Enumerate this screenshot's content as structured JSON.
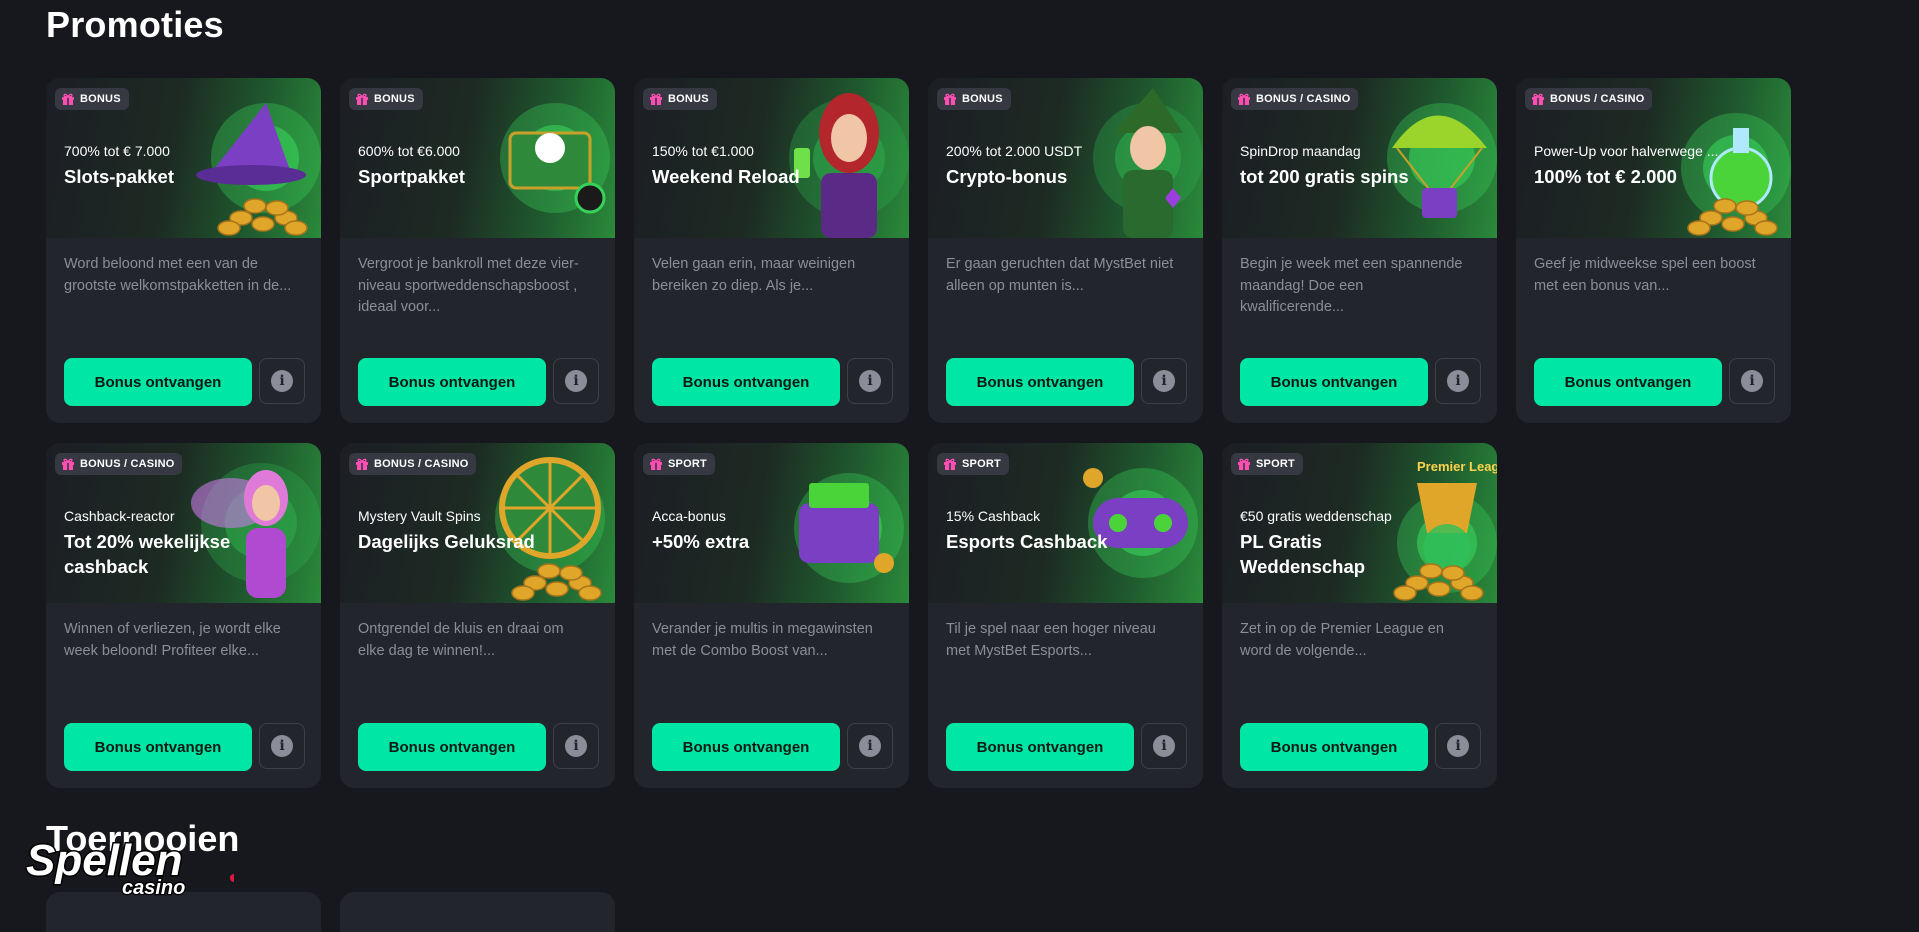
{
  "page_title": "Promoties",
  "next_section_title": "Toernooien",
  "watermark": {
    "brand": "Spellen",
    "sub": "casino"
  },
  "colors": {
    "accent": "#00e6a4",
    "card_bg": "#23252d",
    "page_bg": "#17181d",
    "badge_bg": "#363842",
    "gift": "#ff4fb3"
  },
  "cards": [
    {
      "badge": "BONUS",
      "subtitle": "700% tot € 7.000",
      "title": "Slots-pakket",
      "desc": "Word beloond met een van de grootste welkomstpakketten in de...",
      "button": "Bonus ontvangen",
      "icon": "gift-icon",
      "art": "witch-hat-gold"
    },
    {
      "badge": "BONUS",
      "subtitle": "600% tot €6.000",
      "title": "Sportpakket",
      "desc": "Vergroot je bankroll met deze vier-niveau sportweddenschapsboost , ideaal voor...",
      "button": "Bonus ontvangen",
      "icon": "gift-icon",
      "art": "treasure-chest"
    },
    {
      "badge": "BONUS",
      "subtitle": "150% tot €1.000",
      "title": "Weekend Reload",
      "desc": "Velen gaan erin, maar weinigen bereiken zo diep. Als je...",
      "button": "Bonus ontvangen",
      "icon": "gift-icon",
      "art": "red-hair-woman"
    },
    {
      "badge": "BONUS",
      "subtitle": "200% tot 2.000 USDT",
      "title": "Crypto-bonus",
      "desc": "Er gaan geruchten dat MystBet niet alleen op munten is...",
      "button": "Bonus ontvangen",
      "icon": "gift-icon",
      "art": "green-wizard"
    },
    {
      "badge": "BONUS / CASINO",
      "subtitle": "SpinDrop maandag",
      "title": "tot 200 gratis spins",
      "desc": "Begin je week met een spannende maandag! Doe een kwalificerende...",
      "button": "Bonus ontvangen",
      "icon": "gift-icon",
      "art": "parachute"
    },
    {
      "badge": "BONUS / CASINO",
      "subtitle": "Power-Up voor halverwege ...",
      "title": "100% tot € 2.000",
      "desc": "Geef je midweekse spel een boost met een bonus van...",
      "button": "Bonus ontvangen",
      "icon": "gift-icon",
      "art": "potion"
    },
    {
      "badge": "BONUS / CASINO",
      "subtitle": "Cashback-reactor",
      "title": "Tot 20% wekelijkse cashback",
      "desc": "Winnen of verliezen, je wordt elke week beloond! Profiteer elke...",
      "button": "Bonus ontvangen",
      "icon": "gift-icon",
      "art": "fairy"
    },
    {
      "badge": "BONUS / CASINO",
      "subtitle": "Mystery Vault Spins",
      "title": "Dagelijks Geluksrad",
      "desc": "Ontgrendel de kluis en draai om elke dag te winnen!...",
      "button": "Bonus ontvangen",
      "icon": "gift-icon",
      "art": "wheel"
    },
    {
      "badge": "SPORT",
      "subtitle": "Acca-bonus",
      "title": "+50% extra",
      "desc": "Verander je multis in megawinsten met de Combo Boost van...",
      "button": "Bonus ontvangen",
      "icon": "gift-icon",
      "art": "wallet"
    },
    {
      "badge": "SPORT",
      "subtitle": "15% Cashback",
      "title": "Esports Cashback",
      "desc": "Til je spel naar een hoger niveau met MystBet Esports...",
      "button": "Bonus ontvangen",
      "icon": "gift-icon",
      "art": "gamepad"
    },
    {
      "badge": "SPORT",
      "subtitle": "€50 gratis weddenschap",
      "title": "PL Gratis Weddenschap",
      "desc": "Zet in op de Premier League en word de volgende...",
      "button": "Bonus ontvangen",
      "icon": "gift-icon",
      "art": "trophy",
      "art_text": "Premier League"
    }
  ]
}
